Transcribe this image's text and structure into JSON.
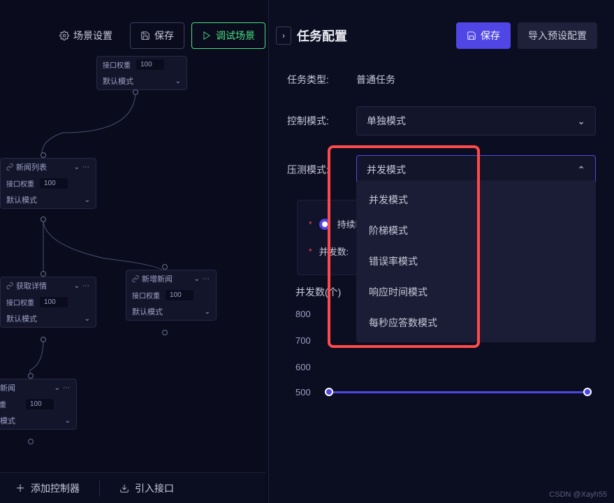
{
  "toolbar": {
    "scene_settings": "场景设置",
    "save": "保存",
    "debug_scene": "调试场景"
  },
  "nodes": {
    "n1": {
      "weight_label": "接口权重",
      "weight_value": "100",
      "mode": "默认模式"
    },
    "n2": {
      "title": "新闻列表",
      "weight_label": "接口权重",
      "weight_value": "100",
      "mode": "默认模式"
    },
    "n3": {
      "title": "获取详情",
      "weight_label": "接口权重",
      "weight_value": "100",
      "mode": "默认模式"
    },
    "n4": {
      "title": "新增新闻",
      "weight_label": "接口权重",
      "weight_value": "100",
      "mode": "默认模式"
    },
    "n5": {
      "title": "论新闻",
      "weight_label": "权重",
      "weight_value": "100",
      "mode": "认模式"
    }
  },
  "panel": {
    "title": "任务配置",
    "save": "保存",
    "import_preset": "导入预设配置",
    "task_type_label": "任务类型:",
    "task_type_value": "普通任务",
    "control_mode_label": "控制模式:",
    "control_mode_value": "单独模式",
    "test_mode_label": "压测模式:",
    "test_mode_value": "并发模式",
    "options": [
      "并发模式",
      "阶梯模式",
      "错误率模式",
      "响应时间模式",
      "每秒应答数模式"
    ],
    "duration_label": "持续时",
    "concurrency_label": "并发数:"
  },
  "chart_data": {
    "type": "line",
    "title": "并发数(个)",
    "ylabel": "",
    "xlabel": "",
    "y_ticks": [
      800,
      700,
      600,
      500
    ],
    "ylim": [
      500,
      800
    ],
    "values": [
      500
    ],
    "slider_value": 500
  },
  "bottom": {
    "add_controller": "添加控制器",
    "import_interface": "引入接口"
  },
  "watermark": "CSDN @Xayh55"
}
